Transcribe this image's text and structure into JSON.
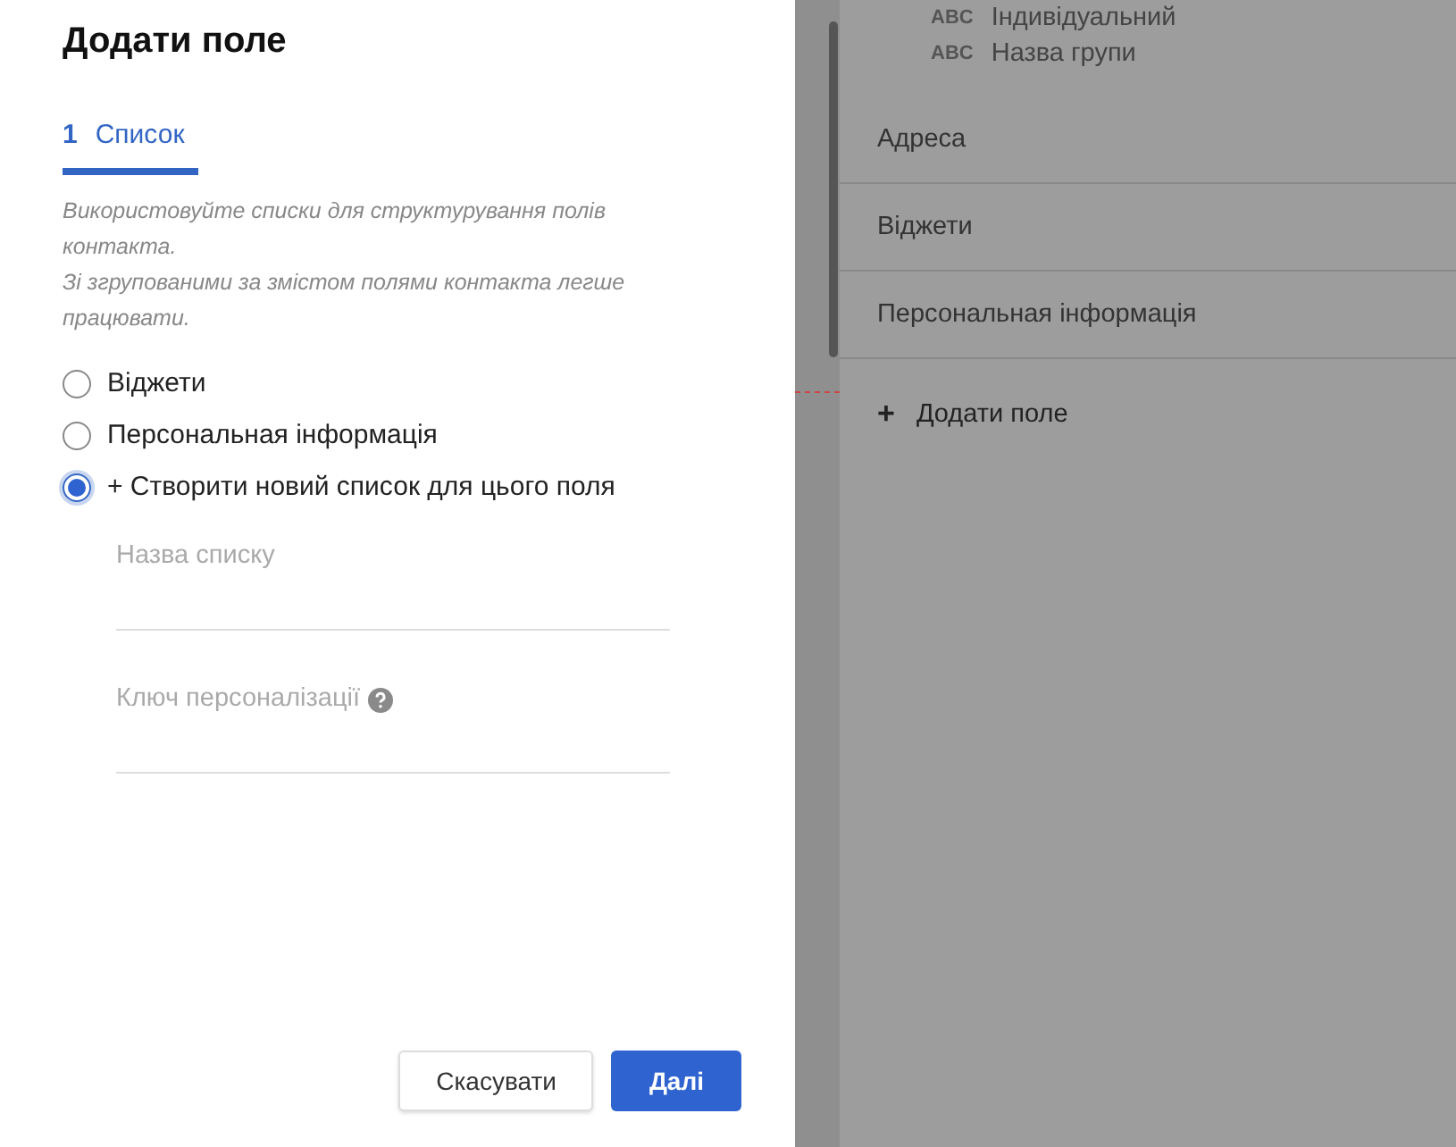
{
  "dialog": {
    "title": "Додати поле",
    "steps": [
      {
        "number": "1",
        "label": "Список",
        "selected": true
      }
    ],
    "description": "Використовуйте списки для структурування полів контакта.\nЗі згрупованими за змістом полями контакта легше працювати.",
    "options": [
      {
        "label": "Віджети",
        "selected": false
      },
      {
        "label": "Персональная інформація",
        "selected": false
      },
      {
        "label": "+ Створити новий список для цього поля",
        "selected": true
      }
    ],
    "fields": [
      {
        "placeholder": "Назва списку",
        "help": false
      },
      {
        "placeholder": "Ключ персоналізації",
        "help": true
      }
    ],
    "buttons": [
      {
        "label": "Скасувати",
        "kind": "secondary"
      },
      {
        "label": "Далі",
        "kind": "primary"
      }
    ]
  },
  "background": {
    "fields": [
      {
        "type": "ABC",
        "label": "Індивідуальний"
      },
      {
        "type": "ABC",
        "label": "Назва групи"
      }
    ],
    "groups": [
      "Адреса",
      "Віджети",
      "Персональная інформація"
    ],
    "add_button": {
      "icon": "+",
      "label": "Додати поле"
    }
  }
}
